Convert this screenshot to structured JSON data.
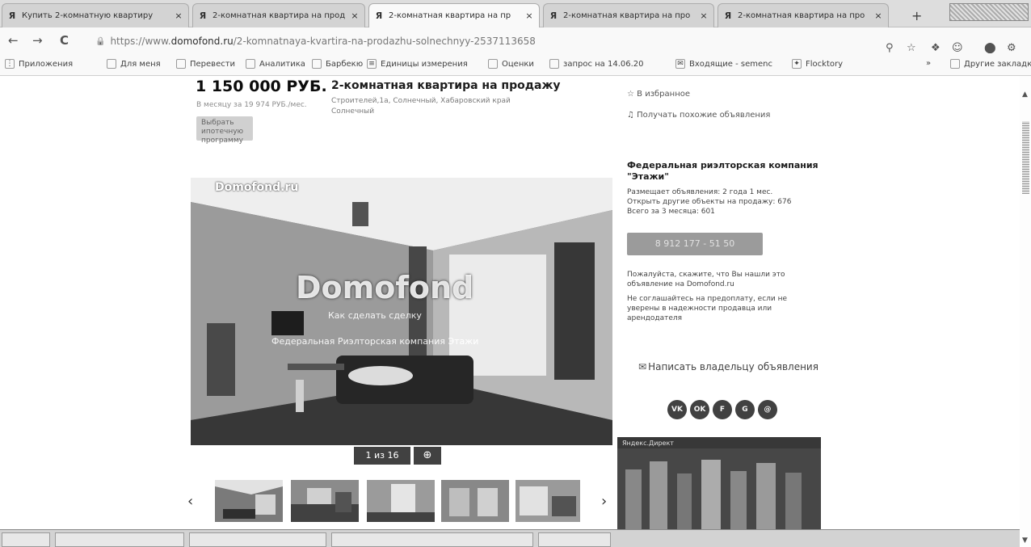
{
  "browser": {
    "tabs": [
      {
        "title": "Купить 2-комнатную квартиру",
        "icon": "domofond-favicon",
        "close": "×",
        "active": false
      },
      {
        "title": "2-комнатная квартира на прод",
        "icon": "domofond-favicon",
        "close": "×",
        "active": false
      },
      {
        "title": "2-комнатная квартира на пр",
        "icon": "domofond-favicon",
        "close": "×",
        "active": true
      },
      {
        "title": "2-комнатная квартира на про",
        "icon": "domofond-favicon",
        "close": "×",
        "active": false
      },
      {
        "title": "2-комнатная квартира на про",
        "icon": "domofond-favicon",
        "close": "×",
        "active": false
      }
    ],
    "new_tab": "+",
    "nav": {
      "back": "←",
      "forward": "→",
      "reload": "C"
    },
    "url_prefix": "https://www.",
    "url_host": "domofond.ru",
    "url_path": "/2-komnatnaya-kvartira-na-prodazhu-solnechnyy-2537113658",
    "toolbar_icons": [
      "search-icon",
      "star-icon",
      "extension-icon",
      "profile-icon",
      "ext-green-icon",
      "ext-settings-icon"
    ],
    "bookmarks": [
      {
        "label": "Приложения",
        "icon": "apps-icon"
      },
      {
        "label": "Для меня",
        "icon": "folder-icon"
      },
      {
        "label": "Перевести",
        "icon": "folder-icon"
      },
      {
        "label": "Аналитика",
        "icon": "folder-icon"
      },
      {
        "label": "Барбекю",
        "icon": "folder-icon"
      },
      {
        "label": "Единицы измерения",
        "icon": "ruler-icon"
      },
      {
        "label": "Оценки",
        "icon": "folder-icon"
      },
      {
        "label": "запрос на 14.06.20",
        "icon": "folder-icon"
      },
      {
        "label": "Входящие - semenc",
        "icon": "mail-icon"
      },
      {
        "label": "Flocktory",
        "icon": "flocktory-icon"
      }
    ],
    "bookmarks_more": "»",
    "other_bookmarks": "Другие закладки"
  },
  "listing": {
    "price": "1 150 000 РУБ.",
    "price_per_m2": "В месяцу за 19 974 РУБ./мес.",
    "mortgage_button": "Выбрать ипотечную программу",
    "title": "2-комнатная квартира на продажу",
    "address_line1": "Строителей,1а, Солнечный, Хабаровский край",
    "address_line2": "Солнечный",
    "photo_watermark_corner": "Domofond.ru",
    "photo_watermark_big": "Domofond",
    "photo_watermark_small1": "Как сделать сделку",
    "photo_watermark_small2": "Федеральная Риэлторская компания Этажи",
    "photo_counter": "1 из 16",
    "zoom_icon": "⊕",
    "prev_arrow": "‹",
    "next_arrow": "›"
  },
  "sidebar": {
    "favorites": "В избранное",
    "notify": "Получать похожие объявления",
    "agency_name": "Федеральная риэлторская компания \"Этажи\"",
    "agency_posting": "Размещает объявления: 2 года 1 мес.",
    "agency_other": "Открыть другие объекты на продажу: 676",
    "agency_total": "Всего за 3 месяца: 601",
    "phone_button": "8 912 177 - 51 50",
    "please_say": "Пожалуйста, скажите, что Вы нашли это объявление на Domofond.ru",
    "warning": "Не соглашайтесь на предоплату, если не уверены в надежности продавца или арендодателя",
    "write_owner": "Написать владельцу объявления",
    "socials": [
      "VK",
      "OK",
      "F",
      "G",
      "@"
    ],
    "ad_label": "Яндекс.Директ"
  },
  "taskbar": {
    "items": [
      "",
      "",
      "",
      "",
      ""
    ]
  }
}
